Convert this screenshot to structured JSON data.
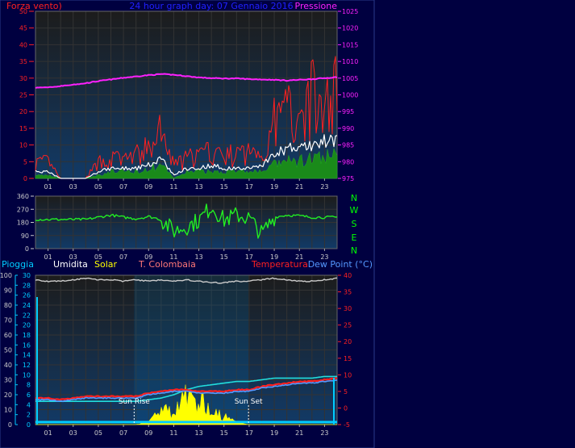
{
  "theme": {
    "background": "#000040",
    "plot_top": "#1c1c1c",
    "plot_bottom": "#123a66",
    "grid": "#333333",
    "sky": "#0077bb"
  },
  "header": {
    "left": "Forza vento)",
    "center": "24 hour graph day: 07 Gennaio 2016",
    "right": "Pressione",
    "left_color": "#ff2020",
    "center_color": "#2020ff",
    "right_color": "#ff20ff"
  },
  "legend2": {
    "pioggia": "Pioggia",
    "umidita": "Umidita",
    "solar": "Solar",
    "tcolombaia": "T. Colombaia",
    "temperatura": "Temperatura",
    "dewpoint": "Dew Point (°C)",
    "pioggia_color": "#00ccff",
    "umidita_color": "#ffffff",
    "solar_color": "#ffff00",
    "tcolombaia_color": "#ff7777",
    "temperatura_color": "#ff2020",
    "dewpoint_color": "#5599ff"
  },
  "compass": {
    "labels": [
      "N",
      "W",
      "S",
      "E",
      "N"
    ],
    "color": "#00ff00"
  },
  "annotations": {
    "sunrise": "Sun Rise",
    "sunset": "Sun Set"
  },
  "chart_data": [
    {
      "type": "line",
      "name": "wind-pressure",
      "x_ticks": [
        "01",
        "03",
        "05",
        "07",
        "09",
        "11",
        "13",
        "15",
        "17",
        "19",
        "21",
        "23"
      ],
      "wind_axis": {
        "ylim": [
          0,
          50
        ],
        "ticks": [
          0,
          5,
          10,
          15,
          20,
          25,
          30,
          35,
          40,
          45,
          50
        ],
        "color": "#ff2020"
      },
      "pressure_axis": {
        "ylim": [
          975,
          1025
        ],
        "ticks": [
          975,
          980,
          985,
          990,
          995,
          1000,
          1005,
          1010,
          1015,
          1020,
          1025
        ],
        "color": "#ff20ff"
      },
      "pressure_hourly": [
        1002.1,
        1002.3,
        1002.6,
        1003.0,
        1003.5,
        1004.1,
        1004.6,
        1005.1,
        1005.5,
        1005.9,
        1006.2,
        1006.0,
        1005.6,
        1005.2,
        1005.0,
        1004.9,
        1004.9,
        1004.7,
        1004.6,
        1004.5,
        1004.3,
        1004.5,
        1004.7,
        1005.0,
        1005.3
      ],
      "gust_hourly": [
        5,
        5,
        0,
        0,
        0,
        5,
        6,
        6,
        7,
        9,
        14,
        4,
        6,
        7,
        8,
        7,
        7,
        8,
        8,
        17,
        21,
        22,
        25,
        22,
        28
      ],
      "avg_hourly": [
        2,
        2,
        0,
        0,
        0,
        2,
        3,
        3,
        3,
        4,
        6,
        1,
        3,
        3,
        4,
        3,
        3,
        3,
        4,
        7,
        9,
        9,
        10,
        11,
        12
      ],
      "speed_hourly": [
        1,
        1,
        0,
        0,
        0,
        1,
        2,
        2,
        2,
        3,
        4,
        0,
        2,
        2,
        2,
        2,
        2,
        2,
        2,
        4,
        5,
        5,
        6,
        6,
        7
      ]
    },
    {
      "type": "line",
      "name": "wind-direction",
      "x_ticks": [
        "01",
        "03",
        "05",
        "07",
        "09",
        "11",
        "13",
        "15",
        "17",
        "19",
        "21",
        "23"
      ],
      "ylim": [
        0,
        360
      ],
      "ticks": [
        0,
        90,
        180,
        270,
        360
      ],
      "direction_hourly": [
        200,
        200,
        200,
        200,
        200,
        215,
        230,
        215,
        205,
        220,
        200,
        120,
        150,
        195,
        290,
        195,
        230,
        210,
        100,
        215,
        230,
        225,
        215,
        215,
        215
      ]
    },
    {
      "type": "line",
      "name": "rain-humidity-solar-temperature",
      "x_ticks": [
        "01",
        "03",
        "05",
        "07",
        "09",
        "11",
        "13",
        "15",
        "17",
        "19",
        "21",
        "23"
      ],
      "percent_axis": {
        "ylim": [
          0,
          100
        ],
        "ticks": [
          0,
          10,
          20,
          30,
          40,
          50,
          60,
          70,
          80,
          90,
          100
        ]
      },
      "rain_axis": {
        "ylim": [
          0,
          30
        ],
        "ticks": [
          0,
          2,
          4,
          6,
          8,
          10,
          12,
          14,
          16,
          18,
          20,
          22,
          24,
          26,
          28,
          30
        ],
        "color": "#00ccff"
      },
      "temp_axis": {
        "ylim": [
          -5,
          40
        ],
        "ticks": [
          -5,
          0,
          5,
          10,
          15,
          20,
          25,
          30,
          35,
          40
        ],
        "color": "#ff2020"
      },
      "humidity_hourly": [
        97,
        96,
        96,
        97,
        98,
        97,
        97,
        96,
        97,
        96,
        97,
        96,
        97,
        96,
        95,
        95,
        96,
        96,
        97,
        98,
        97,
        96,
        96,
        97,
        98
      ],
      "temperature_hourly": [
        3.0,
        3.0,
        2.5,
        3.0,
        3.5,
        3.5,
        3.5,
        3.5,
        3.5,
        4.5,
        5.0,
        5.5,
        5.5,
        5.0,
        5.0,
        5.0,
        5.5,
        5.5,
        6.5,
        7.0,
        7.5,
        8.0,
        8.0,
        8.5,
        9.0
      ],
      "dewpoint_hourly": [
        2.5,
        2.5,
        2.0,
        2.5,
        3.0,
        3.0,
        3.0,
        3.0,
        3.0,
        4.0,
        4.5,
        5.0,
        5.0,
        4.5,
        4.5,
        4.5,
        5.0,
        5.0,
        6.0,
        6.5,
        7.0,
        7.5,
        7.5,
        8.0,
        8.5
      ],
      "tcolombaia_hourly": [
        2.0,
        2.0,
        2.0,
        2.0,
        2.0,
        2.0,
        2.0,
        2.0,
        2.0,
        2.5,
        3.0,
        4.0,
        5.5,
        6.5,
        7.0,
        7.5,
        8.0,
        8.0,
        8.5,
        9.0,
        9.0,
        9.0,
        9.0,
        9.5,
        9.5
      ],
      "rain_cumulative_hourly": [
        0.5,
        0.5,
        0.5,
        0.5,
        0.5,
        0.5,
        0.5,
        0.5,
        0.5,
        0.5,
        0.5,
        0.5,
        0.5,
        0.5,
        0.5,
        0.5,
        0.5,
        0.5,
        0.5,
        0.5,
        0.5,
        0.5,
        0.5,
        0.5,
        0.5
      ],
      "solar_hourly": [
        0,
        0,
        0,
        0,
        0,
        0,
        0,
        0,
        0,
        3,
        12,
        8,
        20,
        18,
        10,
        6,
        2,
        0,
        0,
        0,
        0,
        0,
        0,
        0,
        0
      ],
      "sunrise_hour": 7.85,
      "sunset_hour": 16.95
    }
  ]
}
